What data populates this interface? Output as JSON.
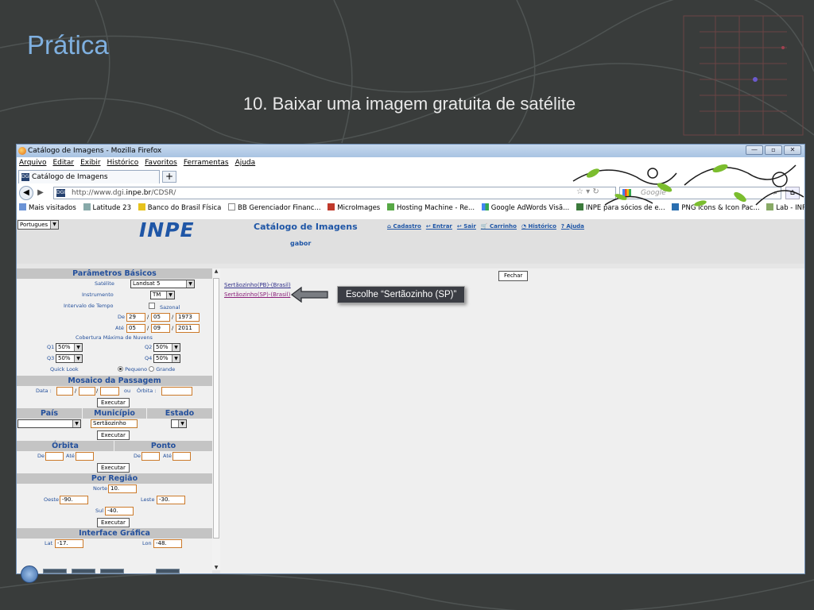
{
  "slide": {
    "title": "Prática",
    "subtitle": "10. Baixar uma imagem gratuita de satélite"
  },
  "browser": {
    "window_title": "Catálogo de Imagens - Mozilla Firefox",
    "window_controls": [
      "—",
      "▫",
      "✕"
    ],
    "menu": [
      "Arquivo",
      "Editar",
      "Exibir",
      "Histórico",
      "Favoritos",
      "Ferramentas",
      "Ajuda"
    ],
    "tab_label": "Catálogo de Imagens",
    "new_tab": "+",
    "url_prefix": "http://www.dgi.",
    "url_domain": "inpe.br",
    "url_suffix": "/CDSR/",
    "search_placeholder": "Google",
    "bookmarks": [
      "Mais visitados",
      "Latitude 23",
      "Banco do Brasil Física",
      "BB Gerenciador Financ...",
      "MicroImages",
      "Hosting Machine - Re...",
      "Google AdWords Visã...",
      "INPE para sócios de e...",
      "PNG Icons & Icon Pac...",
      "Lab - INPE"
    ]
  },
  "app": {
    "language": "Portugues",
    "logo": "INPE",
    "catalog_title": "Catálogo de Imagens",
    "user": "gabor",
    "links": [
      "Cadastro",
      "Entrar",
      "Sair",
      "Carrinho",
      "Histórico",
      "Ajuda"
    ]
  },
  "params": {
    "section": "Parâmetros Básicos",
    "satelite_label": "Satélite",
    "satelite_value": "Landsat 5",
    "instrumento_label": "Instrumento",
    "instrumento_value": "TM",
    "intervalo_label": "Intervalo de Tempo",
    "sazonal_label": "Sazonal",
    "de_label": "De",
    "de_day": "29",
    "de_month": "05",
    "de_year": "1973",
    "ate_label": "Até",
    "ate_day": "05",
    "ate_month": "09",
    "ate_year": "2011",
    "cobertura_label": "Cobertura Máxima de Nuvens",
    "q1_label": "Q1",
    "q1_value": "50%",
    "q2_label": "Q2",
    "q2_value": "50%",
    "q3_label": "Q3",
    "q3_value": "50%",
    "q4_label": "Q4",
    "q4_value": "50%",
    "quicklook_label": "Quick Look",
    "pequeno": "Pequeno",
    "grande": "Grande"
  },
  "mosaico": {
    "section": "Mosaico da Passagem",
    "data_label": "Data :",
    "ou": "ou",
    "orbita_label": "Órbita :",
    "executar": "Executar"
  },
  "local": {
    "pais": "País",
    "municipio": "Município",
    "estado": "Estado",
    "municipio_value": "Sertãozinho",
    "executar": "Executar"
  },
  "orbita_ponto": {
    "orbita": "Órbita",
    "ponto": "Ponto",
    "de": "De",
    "ate": "Até",
    "executar": "Executar"
  },
  "regiao": {
    "section": "Por Região",
    "norte_label": "Norte",
    "norte_value": "10.",
    "oeste_label": "Oeste",
    "oeste_value": "-90.",
    "leste_label": "Leste",
    "leste_value": "-30.",
    "sul_label": "Sul",
    "sul_value": "-40.",
    "executar": "Executar"
  },
  "interface": {
    "section": "Interface Gráfica",
    "lat_label": "Lat",
    "lat_value": "-17.",
    "lon_label": "Lon",
    "lon_value": "-48."
  },
  "results": {
    "fechar": "Fechar",
    "items": [
      "Sertãozinho(PB)-(Brasil)",
      "Sertãozinho(SP)-(Brasil)"
    ],
    "callout": "Escolhe “Sertãozinho (SP)”"
  }
}
